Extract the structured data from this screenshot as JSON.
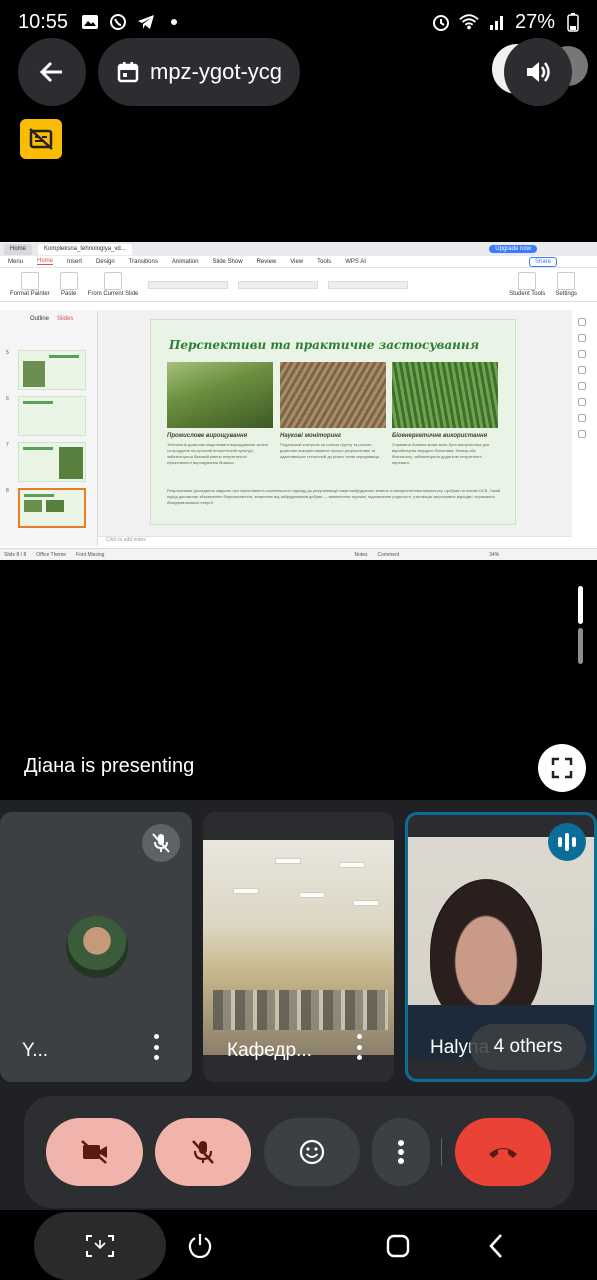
{
  "status_bar": {
    "time": "10:55",
    "battery": "27%"
  },
  "meeting": {
    "code": "mpz-ygot-ycg"
  },
  "shared_screen": {
    "wps": {
      "tab_home": "Home",
      "tab_file": "Kompleksna_tehnologiya_vd...",
      "upgrade": "Upgrade now",
      "menu": [
        "Menu",
        "Home",
        "Insert",
        "Design",
        "Transitions",
        "Animation",
        "Slide Show",
        "Review",
        "View",
        "Tools",
        "WPS AI"
      ],
      "share": "Share",
      "ribbon_labels": [
        "Format Painter",
        "Paste",
        "From Current Slide",
        "Student Tools",
        "Settings"
      ],
      "panel_tabs": [
        "Outline",
        "Slides"
      ],
      "thumb_numbers": [
        "5",
        "6",
        "7",
        "8"
      ],
      "notes_placeholder": "Click to add notes",
      "status": [
        "Slide 8 / 8",
        "Office Theme",
        "Font Missing",
        "Notes",
        "Comment",
        "34%"
      ]
    },
    "slide": {
      "title": "Перспективи та практичне застосування",
      "col1_heading": "Промислове вирощування",
      "col1_text": "Технологія дозволяє моделювати вирощування зелені та продуктів на сучасній енергетичній культурі, забезпечуючи базовий рівень енергетичної ефективності вирощування біомаси.",
      "col2_heading": "Наукові моніторинг",
      "col2_text": "Подальший контроль за станом ґрунту та рослин дозволяє використовувати процес результативні та адаптивніших технологій до різних типів середовища.",
      "col3_heading": "Біоенергетичне використання",
      "col3_text": "Отримана біомаса може мати бути використана для виробництва твердого біопалива, біогазу або біоетанолу, забезпечуючи додаткові енергетичні переваги.",
      "footer_text": "Результатами досліджень свідчать про ефективність комплексного підходу до рекультивації нафтозабруднених земель із використанням міскантусу і добрив на основі ОСВ. Такий підхід допомогає збереженню біорізноманіття, зниженню від забруднювачів добрив — виникнення торишні, відновлення родючості, утилізація загрозливих відходів і отримання біовідновлюваної енергії."
    }
  },
  "presenting_label": "Діана is presenting",
  "participants": [
    {
      "name": "Y...",
      "muted": true
    },
    {
      "name": "Кафедр..."
    },
    {
      "name": "Halyna",
      "speaking": true
    }
  ],
  "others_label": "4 others",
  "colors": {
    "accent_blue": "#0b6e99",
    "hangup_red": "#ea4335",
    "off_button": "#f0b4ac",
    "captions_yellow": "#fbbc04"
  },
  "icons": {
    "back": "arrow-left-icon",
    "calendar": "calendar-icon",
    "sound": "speaker-icon",
    "captions": "captions-off-icon",
    "fullscreen": "fullscreen-icon",
    "camera_off": "camera-off-icon",
    "mic_off": "mic-off-icon",
    "emoji": "emoji-icon",
    "more": "more-vert-icon",
    "hangup": "call-end-icon"
  }
}
